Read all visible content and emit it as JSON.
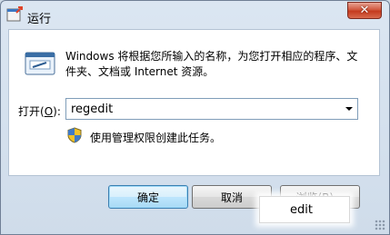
{
  "window": {
    "title": "运行",
    "close_glyph": "✕",
    "run_icon": "run-dialog-icon",
    "accent_color": "#c43a1e"
  },
  "dialog": {
    "description": "Windows 将根据您所输入的名称，为您打开相应的程序、文件夹、文档或 Internet 资源。",
    "open_label_prefix": "打开(",
    "open_label_key": "O",
    "open_label_suffix": "):",
    "open_value": "regedit",
    "admin_note": "使用管理权限创建此任务。"
  },
  "buttons": {
    "ok": "确定",
    "cancel": "取消",
    "browse": "浏览(B)..."
  },
  "tooltip": {
    "text": "edit"
  }
}
